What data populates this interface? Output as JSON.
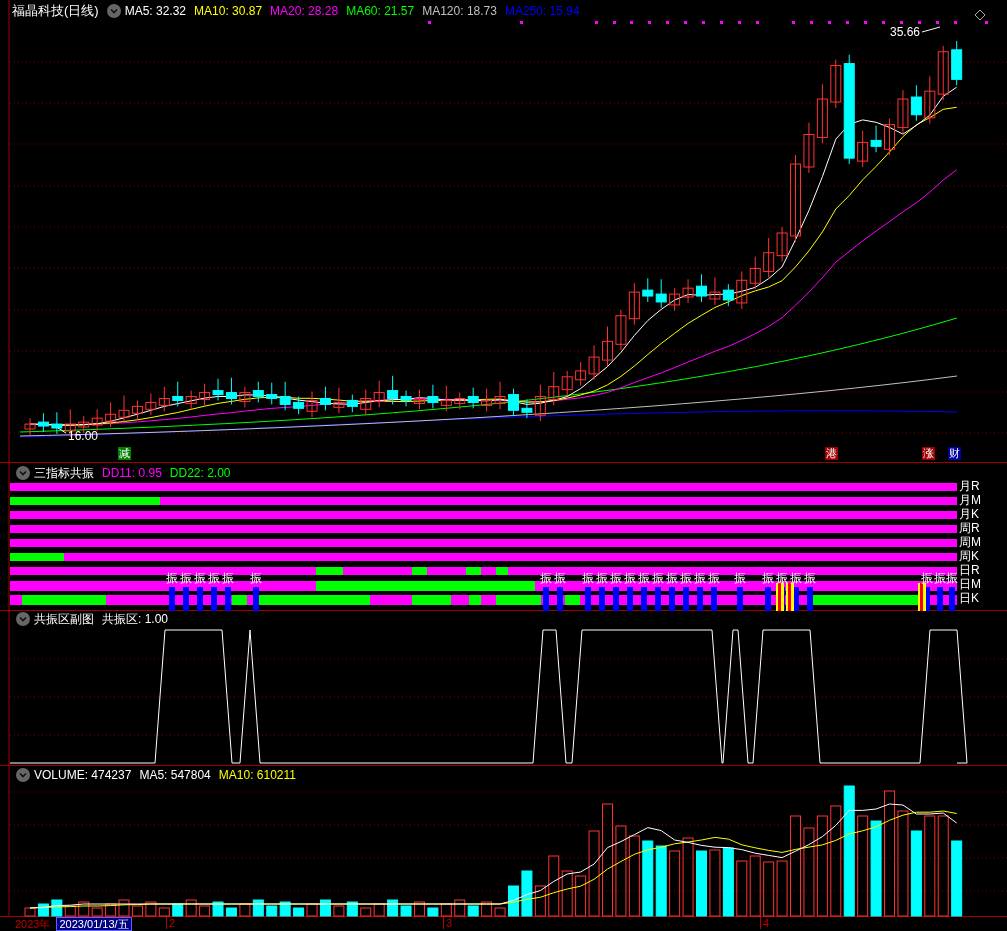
{
  "main_chart": {
    "title": "福晶科技(日线)",
    "indicators": [
      {
        "label": "MA5: 32.32",
        "color": "#ffffff"
      },
      {
        "label": "MA10: 30.87",
        "color": "#ffff00"
      },
      {
        "label": "MA20: 28.28",
        "color": "#ff00ff"
      },
      {
        "label": "MA60: 21.57",
        "color": "#00ff00"
      },
      {
        "label": "MA120: 18.73",
        "color": "#c0c0c0"
      },
      {
        "label": "MA250: 15.94",
        "color": "#0000ff"
      }
    ],
    "high_label": "35.66",
    "low_label": "16.00",
    "markers": [
      {
        "text": "减",
        "color": "#008000"
      },
      {
        "text": "港",
        "color": "#a00000"
      },
      {
        "text": "涨",
        "color": "#a00000"
      },
      {
        "text": "财",
        "color": "#0000a0"
      }
    ]
  },
  "resonance_panel": {
    "title": "三指标共振",
    "indicators": [
      {
        "label": "DD11: 0.95",
        "color": "#ff00ff"
      },
      {
        "label": "DD22: 2.00",
        "color": "#00ff00"
      }
    ],
    "row_labels": [
      "月R",
      "月M",
      "月K",
      "周R",
      "周M",
      "周K",
      "日R",
      "日M",
      "日K"
    ],
    "marks": [
      "振",
      "振",
      "振",
      "振",
      "振",
      "振",
      "振",
      "振",
      "振",
      "振",
      "振",
      "振",
      "振",
      "振",
      "振",
      "振",
      "振",
      "振",
      "振",
      "振",
      "振",
      "振",
      "振",
      "振",
      "振",
      "振"
    ]
  },
  "zone_panel": {
    "title": "共振区副图",
    "indicators": [
      {
        "label": "共振区: 1.00",
        "color": "#ffffff"
      }
    ]
  },
  "volume_panel": {
    "indicators": [
      {
        "label": "VOLUME: 474237",
        "color": "#ffffff"
      },
      {
        "label": "MA5: 547804",
        "color": "#ffffff"
      },
      {
        "label": "MA10: 610211",
        "color": "#ffff00"
      }
    ]
  },
  "time_axis": {
    "year": "2023年",
    "date": "2023/01/13/五",
    "ticks": [
      "2",
      "3",
      "4"
    ]
  }
}
